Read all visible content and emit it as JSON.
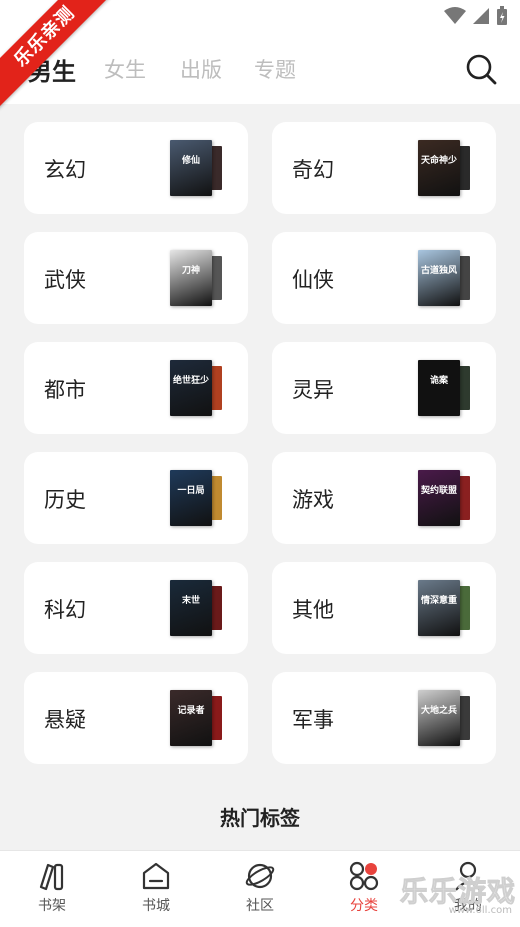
{
  "ribbon": {
    "text": "乐乐亲测"
  },
  "tabs": [
    {
      "label": "男生",
      "active": true
    },
    {
      "label": "女生",
      "active": false
    },
    {
      "label": "出版",
      "active": false
    },
    {
      "label": "专题",
      "active": false
    }
  ],
  "categories": [
    {
      "label": "玄幻",
      "cover_title": "修仙",
      "cover_color": "#4a5a70",
      "back_color": "#3a2a2a"
    },
    {
      "label": "奇幻",
      "cover_title": "天命神少",
      "cover_color": "#3b2a22",
      "back_color": "#2a2a2a"
    },
    {
      "label": "武侠",
      "cover_title": "刀神",
      "cover_color": "#e6e6e6",
      "back_color": "#555555"
    },
    {
      "label": "仙侠",
      "cover_title": "古道独风",
      "cover_color": "#a9c6e0",
      "back_color": "#444444"
    },
    {
      "label": "都市",
      "cover_title": "绝世狂少",
      "cover_color": "#1e2a3a",
      "back_color": "#b04020"
    },
    {
      "label": "灵异",
      "cover_title": "诡案",
      "cover_color": "#111111",
      "back_color": "#2e3a2e"
    },
    {
      "label": "历史",
      "cover_title": "一日局",
      "cover_color": "#1f3a5a",
      "back_color": "#c08a30"
    },
    {
      "label": "游戏",
      "cover_title": "契约联盟",
      "cover_color": "#4a1a4a",
      "back_color": "#8a2020"
    },
    {
      "label": "科幻",
      "cover_title": "末世",
      "cover_color": "#1a2a3a",
      "back_color": "#6a1a1a"
    },
    {
      "label": "其他",
      "cover_title": "情深意重",
      "cover_color": "#6a7a8a",
      "back_color": "#4a6a3a"
    },
    {
      "label": "悬疑",
      "cover_title": "记录者",
      "cover_color": "#3a2a2a",
      "back_color": "#8a1a1a"
    },
    {
      "label": "军事",
      "cover_title": "大地之兵",
      "cover_color": "#cfcfcf",
      "back_color": "#3a3a3a"
    }
  ],
  "hot_tags_title": "热门标签",
  "nav": [
    {
      "label": "书架",
      "icon": "bookshelf-icon",
      "active": false
    },
    {
      "label": "书城",
      "icon": "bookstore-icon",
      "active": false
    },
    {
      "label": "社区",
      "icon": "community-icon",
      "active": false
    },
    {
      "label": "分类",
      "icon": "category-icon",
      "active": true
    },
    {
      "label": "我的",
      "icon": "profile-icon",
      "active": false
    }
  ],
  "watermark": {
    "text": "乐乐游戏",
    "sub": "www.6ll.com"
  },
  "colors": {
    "accent": "#e8433d",
    "ribbon": "#e2231a",
    "background": "#f2f2f2"
  }
}
